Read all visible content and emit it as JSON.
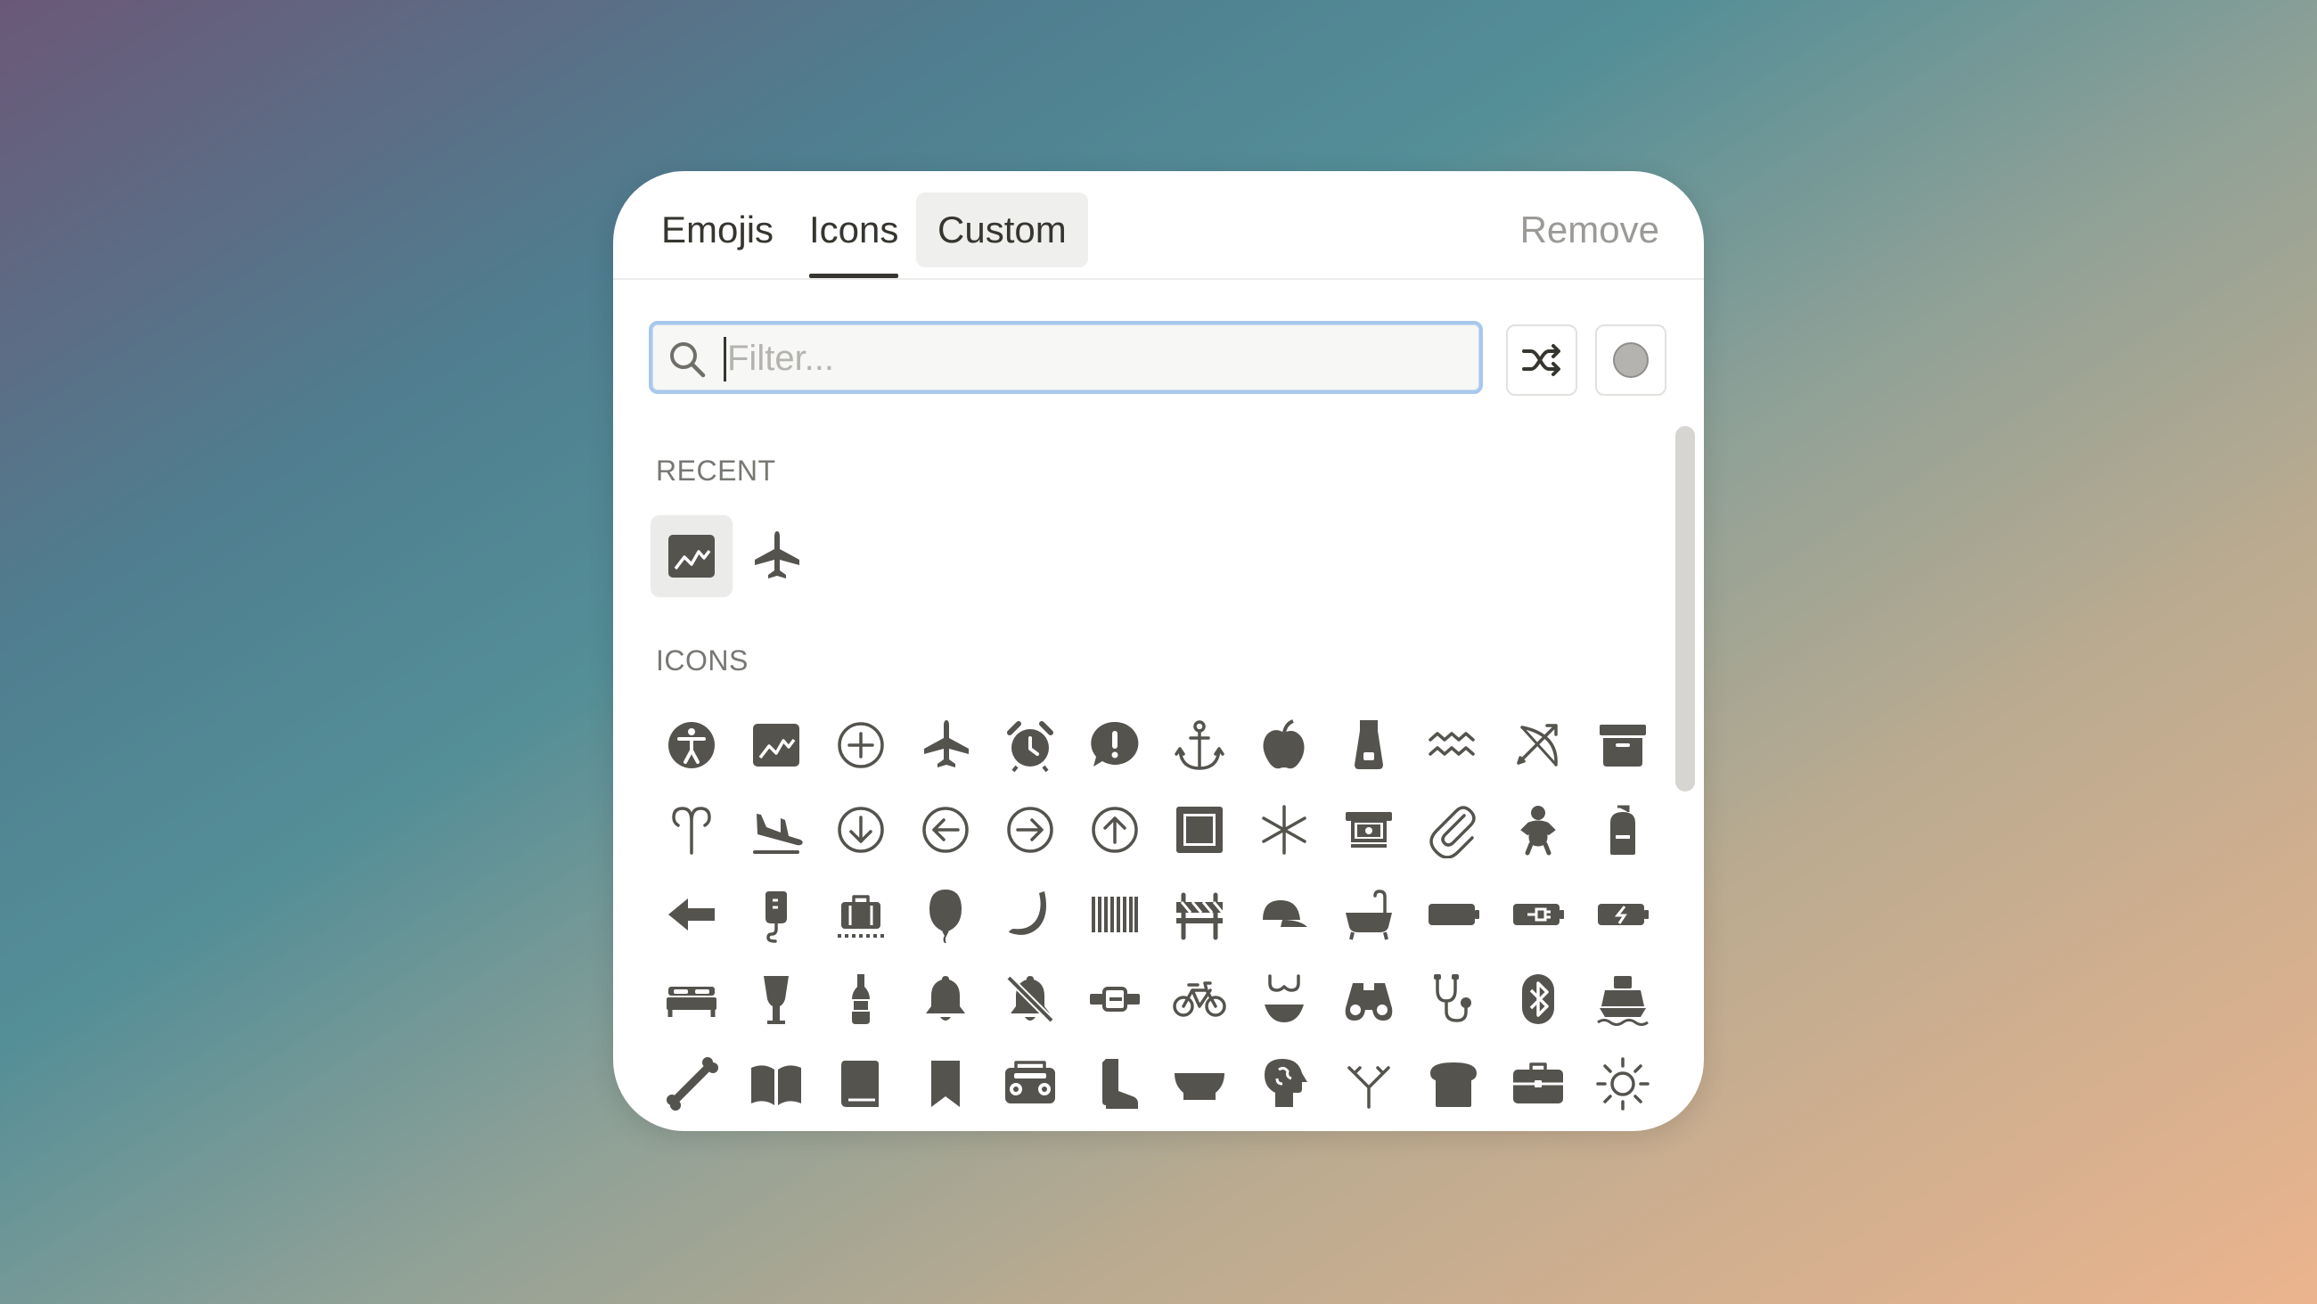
{
  "tabs": [
    {
      "label": "Emojis"
    },
    {
      "label": "Icons",
      "active": true
    },
    {
      "label": "Custom"
    }
  ],
  "remove_label": "Remove",
  "search": {
    "placeholder": "Filter...",
    "value": ""
  },
  "sections": {
    "recent_label": "RECENT",
    "icons_label": "ICONS"
  },
  "recent": [
    "chart-line",
    "airplane"
  ],
  "icons": [
    "accessibility",
    "chart-line",
    "add-circle",
    "airplane",
    "alarm-clock",
    "alert-bubble",
    "anchor",
    "apple",
    "apron",
    "aquarius",
    "archery",
    "archive",
    "aries",
    "airplane-landing",
    "arrow-down-circle",
    "arrow-left-circle",
    "arrow-right-circle",
    "arrow-up-circle",
    "artboard",
    "asterisk",
    "atm",
    "attachment",
    "baby",
    "backpack",
    "arrow-left",
    "bag-iv",
    "baggage-claim",
    "balloon",
    "banana",
    "barcode",
    "barrier",
    "cap",
    "bathtub",
    "battery",
    "battery-charging-plug",
    "battery-charging",
    "bed",
    "beer",
    "beer-bottle",
    "bell",
    "bell-slash",
    "belt",
    "bicycle",
    "bikini",
    "binoculars",
    "biohazard-stethoscope",
    "bluetooth",
    "boat",
    "bone",
    "book-open",
    "book",
    "bookmark",
    "boombox",
    "boot",
    "bowl",
    "brain-head",
    "branch",
    "bread",
    "briefcase",
    "brightness"
  ],
  "colors": {
    "icon": "#55534e",
    "accent": "#a8c8ec",
    "selected_bg": "#ebebea",
    "color_dot": "#b4b3af"
  }
}
